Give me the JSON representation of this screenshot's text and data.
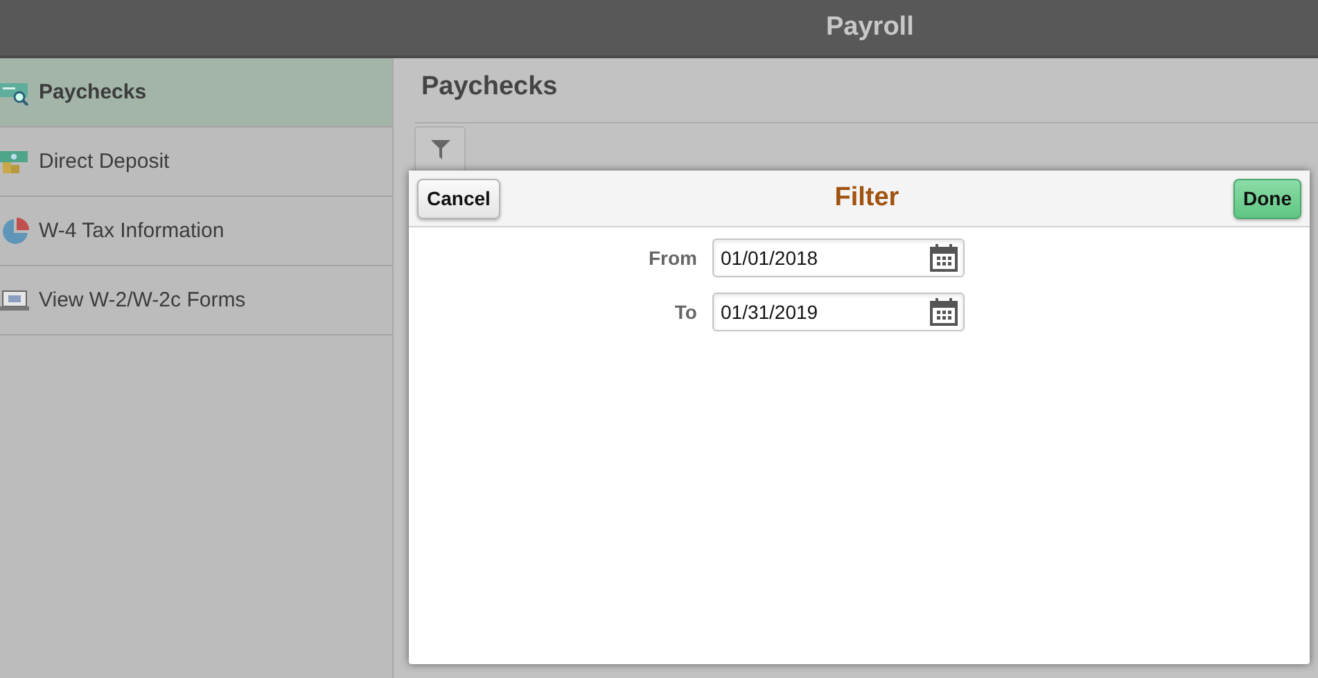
{
  "header": {
    "title": "Payroll"
  },
  "sidebar": {
    "items": [
      {
        "label": "Paychecks",
        "selected": true
      },
      {
        "label": "Direct Deposit",
        "selected": false
      },
      {
        "label": "W-4 Tax Information",
        "selected": false
      },
      {
        "label": "View W-2/W-2c Forms",
        "selected": false
      }
    ]
  },
  "content": {
    "title": "Paychecks"
  },
  "dialog": {
    "title": "Filter",
    "cancel": "Cancel",
    "done": "Done",
    "fields": [
      {
        "label": "From",
        "value": "01/01/2018"
      },
      {
        "label": "To",
        "value": "01/31/2019"
      }
    ]
  }
}
